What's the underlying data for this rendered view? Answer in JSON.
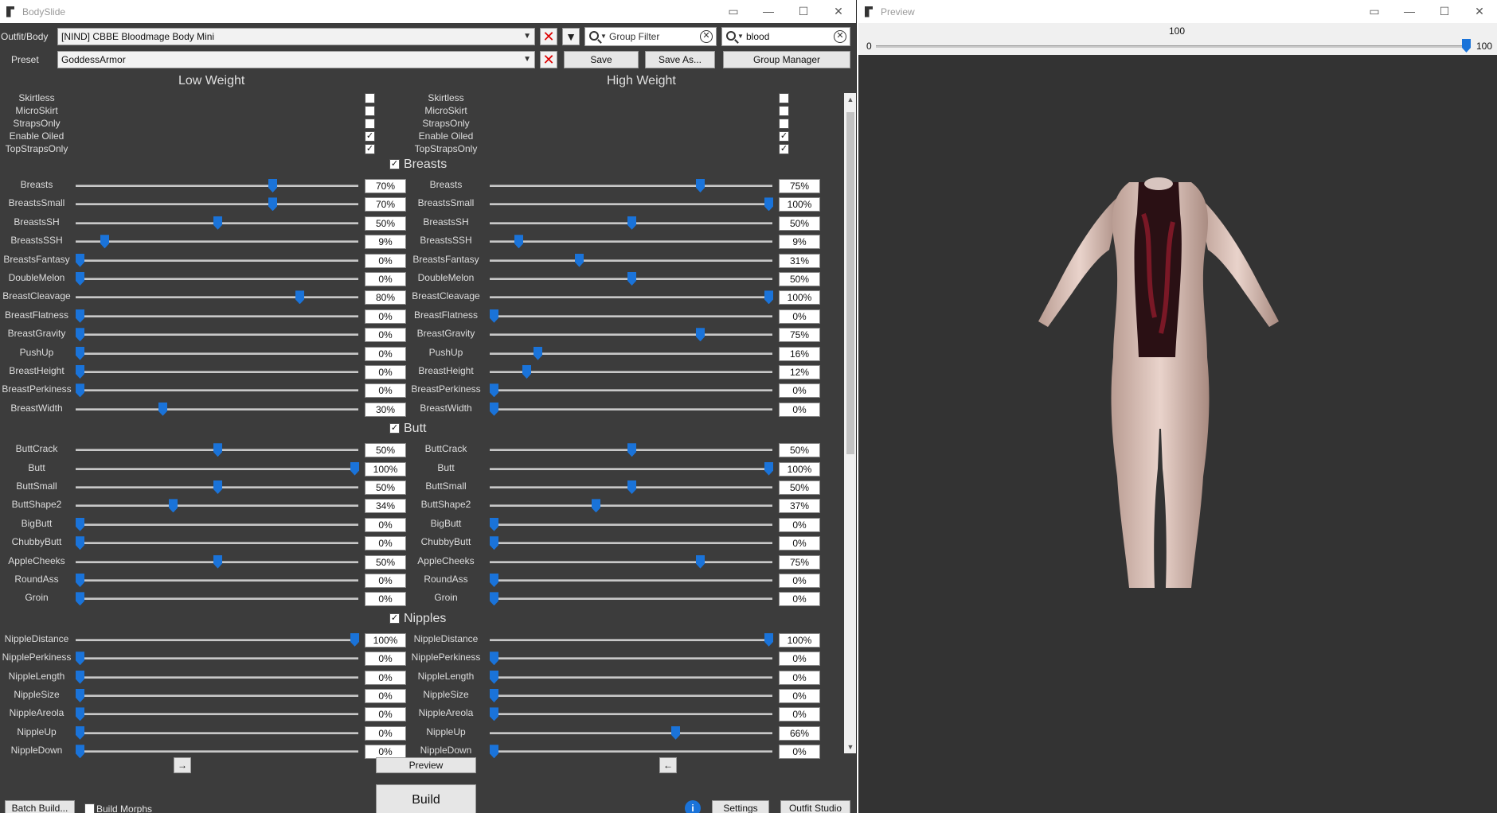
{
  "bodyslide": {
    "title": "BodySlide",
    "outfit_label": "Outfit/Body",
    "outfit_value": "[NIND] CBBE Bloodmage Body Mini",
    "preset_label": "Preset",
    "preset_value": "GoddessArmor",
    "group_filter_placeholder": "Group Filter",
    "search_value": "blood",
    "save_label": "Save",
    "saveas_label": "Save As...",
    "group_manager_label": "Group Manager",
    "low_weight": "Low Weight",
    "high_weight": "High Weight",
    "arrow_right": "→",
    "arrow_left": "←",
    "preview_label": "Preview",
    "build_label": "Build",
    "batch_build_label": "Batch Build...",
    "build_morphs_label": "Build Morphs",
    "settings_label": "Settings",
    "outfit_studio_label": "Outfit Studio",
    "info_icon": "i"
  },
  "checkbox_options": [
    {
      "name": "Skirtless",
      "low": false,
      "high": false
    },
    {
      "name": "MicroSkirt",
      "low": false,
      "high": false
    },
    {
      "name": "StrapsOnly",
      "low": false,
      "high": false
    },
    {
      "name": "Enable Oiled",
      "low": true,
      "high": true
    },
    {
      "name": "TopStrapsOnly",
      "low": true,
      "high": true
    }
  ],
  "categories": [
    {
      "name": "Breasts",
      "checked": true,
      "sliders": [
        {
          "name": "Breasts",
          "low": 70,
          "high": 75
        },
        {
          "name": "BreastsSmall",
          "low": 70,
          "high": 100
        },
        {
          "name": "BreastsSH",
          "low": 50,
          "high": 50
        },
        {
          "name": "BreastsSSH",
          "low": 9,
          "high": 9
        },
        {
          "name": "BreastsFantasy",
          "low": 0,
          "high": 31
        },
        {
          "name": "DoubleMelon",
          "low": 0,
          "high": 50
        },
        {
          "name": "BreastCleavage",
          "low": 80,
          "high": 100
        },
        {
          "name": "BreastFlatness",
          "low": 0,
          "high": 0
        },
        {
          "name": "BreastGravity",
          "low": 0,
          "high": 75
        },
        {
          "name": "PushUp",
          "low": 0,
          "high": 16
        },
        {
          "name": "BreastHeight",
          "low": 0,
          "high": 12
        },
        {
          "name": "BreastPerkiness",
          "low": 0,
          "high": 0
        },
        {
          "name": "BreastWidth",
          "low": 30,
          "high": 0
        }
      ]
    },
    {
      "name": "Butt",
      "checked": true,
      "sliders": [
        {
          "name": "ButtCrack",
          "low": 50,
          "high": 50
        },
        {
          "name": "Butt",
          "low": 100,
          "high": 100
        },
        {
          "name": "ButtSmall",
          "low": 50,
          "high": 50
        },
        {
          "name": "ButtShape2",
          "low": 34,
          "high": 37
        },
        {
          "name": "BigButt",
          "low": 0,
          "high": 0
        },
        {
          "name": "ChubbyButt",
          "low": 0,
          "high": 0
        },
        {
          "name": "AppleCheeks",
          "low": 50,
          "high": 75
        },
        {
          "name": "RoundAss",
          "low": 0,
          "high": 0
        },
        {
          "name": "Groin",
          "low": 0,
          "high": 0
        }
      ]
    },
    {
      "name": "Nipples",
      "checked": true,
      "sliders": [
        {
          "name": "NippleDistance",
          "low": 100,
          "high": 100
        },
        {
          "name": "NipplePerkiness",
          "low": 0,
          "high": 0
        },
        {
          "name": "NippleLength",
          "low": 0,
          "high": 0
        },
        {
          "name": "NippleSize",
          "low": 0,
          "high": 0
        },
        {
          "name": "NippleAreola",
          "low": 0,
          "high": 0
        },
        {
          "name": "NippleUp",
          "low": 0,
          "high": 66
        },
        {
          "name": "NippleDown",
          "low": 0,
          "high": 0
        }
      ]
    }
  ],
  "preview": {
    "title": "Preview",
    "weight_top": "100",
    "weight_min": "0",
    "weight_max": "100",
    "weight_value": 100
  },
  "colors": {
    "accent": "#1a73d9",
    "bg": "#3c3c3c",
    "preview_bg": "#333333"
  }
}
